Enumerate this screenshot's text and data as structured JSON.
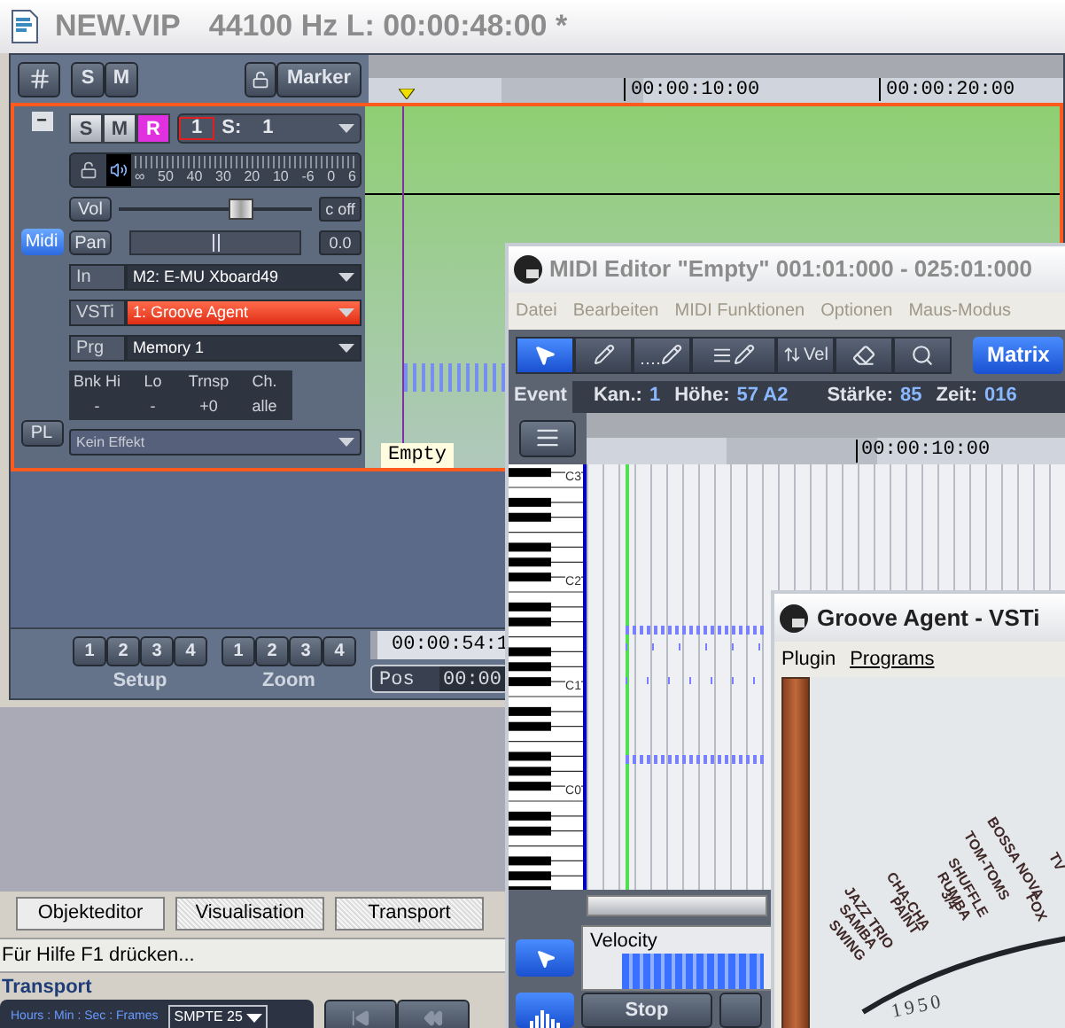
{
  "main_window": {
    "title": "NEW.VIP",
    "info": "44100 Hz L: 00:00:48:00 *"
  },
  "toolbar": {
    "solo": "S",
    "mute": "M",
    "marker": "Marker"
  },
  "ruler": {
    "ticks": [
      "00:00:10:00",
      "00:00:20:00"
    ]
  },
  "track": {
    "collapse": "−",
    "midi": "Midi",
    "pl": "PL",
    "buttons": [
      {
        "label": "S",
        "on": false
      },
      {
        "label": "M",
        "on": false
      },
      {
        "label": "R",
        "on": true
      }
    ],
    "number": "1",
    "sync_label": "S:",
    "sync_value": "1",
    "meter_scale": [
      "∞",
      "50",
      "40",
      "30",
      "20",
      "10",
      "-6",
      "0",
      "6"
    ],
    "vol": {
      "label": "Vol",
      "level": 0.63,
      "value": "c off"
    },
    "pan": {
      "label": "Pan",
      "level": 0.5,
      "value": "0.0"
    },
    "routing": [
      {
        "label": "In",
        "value": "M2: E-MU Xboard49",
        "kind": "normal"
      },
      {
        "label": "VSTi",
        "value": "1: Groove Agent",
        "kind": "highlight"
      },
      {
        "label": "Prg",
        "value": "Memory 1",
        "kind": "normal"
      }
    ],
    "bank": {
      "columns": [
        "Bnk Hi",
        "Lo",
        "Trnsp",
        "Ch."
      ],
      "values": [
        "-",
        "-",
        "+0",
        "alle"
      ]
    },
    "effect": "Kein Effekt",
    "clip": "Empty"
  },
  "setup": {
    "label": "Setup",
    "buttons": [
      "1",
      "2",
      "3",
      "4"
    ]
  },
  "zoom": {
    "label": "Zoom",
    "buttons": [
      "1",
      "2",
      "3",
      "4"
    ]
  },
  "time": "00:00:54:1",
  "pos": {
    "label": "Pos",
    "value": "00:00"
  },
  "tabs": [
    {
      "label": "Objekteditor",
      "selected": true
    },
    {
      "label": "Visualisation",
      "selected": false
    },
    {
      "label": "Transport",
      "selected": false
    }
  ],
  "status_bar": "Für Hilfe F1 drücken...",
  "transport": {
    "title": "Transport",
    "format": "Hours : Min : Sec : Frames",
    "mode": "SMPTE 25"
  },
  "midi_editor": {
    "title": "MIDI Editor \"Empty\" 001:01:000 - 025:01:000",
    "menu": [
      "Datei",
      "Bearbeiten",
      "MIDI Funktionen",
      "Optionen",
      "Maus-Modus"
    ],
    "tools": [
      {
        "kind": "arrow",
        "selected": true
      },
      {
        "kind": "pencil",
        "selected": false
      },
      {
        "kind": "dots-pencil",
        "selected": false
      },
      {
        "kind": "lines-pencil",
        "selected": false
      },
      {
        "kind": "vel",
        "label": "Vel",
        "selected": false
      },
      {
        "kind": "eraser",
        "selected": false
      },
      {
        "kind": "zoom",
        "selected": false
      }
    ],
    "matrix": "Matrix",
    "event": {
      "title": "Event",
      "fields": [
        {
          "label": "Kan.:",
          "value": "1"
        },
        {
          "label": "Höhe:",
          "value": "57 A2"
        },
        {
          "label": "Stärke:",
          "value": "85"
        },
        {
          "label": "Zeit:",
          "value": "016"
        }
      ]
    },
    "ruler": "00:00:10:00",
    "octaves": [
      "C3",
      "C2",
      "C1",
      "C0"
    ],
    "velocity": "Velocity",
    "stop": "Stop"
  },
  "groove_agent": {
    "title": "Groove Agent - VSTi",
    "menu": [
      "Plugin",
      "Programs"
    ],
    "styles": [
      "SWING",
      "SAMBA",
      "JAZZ TRIO",
      "PAINT",
      "CHA-CHA",
      "3/4",
      "RUMBA",
      "SHUFFLE",
      "FOX",
      "TOM-TOMS",
      "BOSSA NOVA",
      "TV"
    ],
    "year": "1950"
  }
}
